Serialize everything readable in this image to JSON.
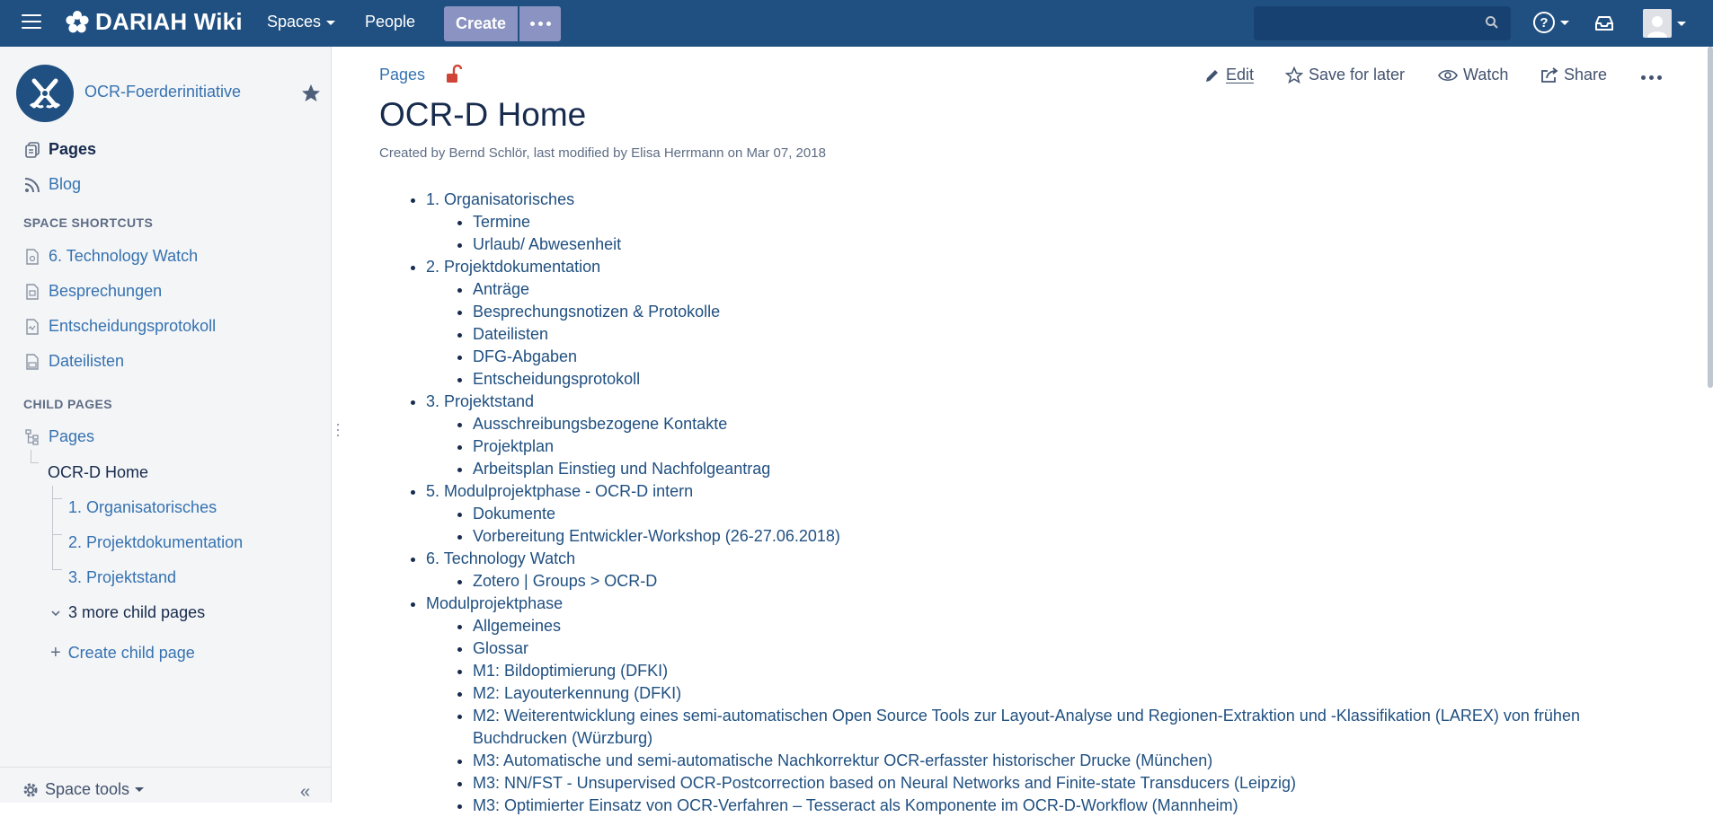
{
  "header": {
    "logo_text": "DARIAH Wiki",
    "spaces_label": "Spaces",
    "people_label": "People",
    "create_label": "Create",
    "search_placeholder": ""
  },
  "sidebar": {
    "space_name": "OCR-Foerderinitiative",
    "nav": [
      {
        "label": "Pages"
      },
      {
        "label": "Blog"
      }
    ],
    "shortcuts_heading": "SPACE SHORTCUTS",
    "shortcuts": [
      {
        "label": "6. Technology Watch"
      },
      {
        "label": "Besprechungen"
      },
      {
        "label": "Entscheidungsprotokoll"
      },
      {
        "label": "Dateilisten"
      }
    ],
    "child_heading": "CHILD PAGES",
    "tree": {
      "root": "Pages",
      "current": "OCR-D Home",
      "children": [
        {
          "label": "1. Organisatorisches"
        },
        {
          "label": "2. Projektdokumentation"
        },
        {
          "label": "3. Projektstand"
        }
      ],
      "more": "3 more child pages",
      "create": "Create child page"
    },
    "space_tools": "Space tools"
  },
  "page": {
    "breadcrumb": "Pages",
    "title": "OCR-D Home",
    "meta": "Created by Bernd Schlör, last modified by Elisa Herrmann on Mar 07, 2018",
    "actions": {
      "edit": "Edit",
      "save": "Save for later",
      "watch": "Watch",
      "share": "Share"
    },
    "tree": [
      {
        "label": "1. Organisatorisches",
        "children": [
          {
            "label": "Termine"
          },
          {
            "label": "Urlaub/ Abwesenheit"
          }
        ]
      },
      {
        "label": "2. Projektdokumentation",
        "children": [
          {
            "label": "Anträge"
          },
          {
            "label": "Besprechungsnotizen & Protokolle"
          },
          {
            "label": "Dateilisten"
          },
          {
            "label": "DFG-Abgaben"
          },
          {
            "label": "Entscheidungsprotokoll"
          }
        ]
      },
      {
        "label": "3. Projektstand",
        "children": [
          {
            "label": "Ausschreibungsbezogene Kontakte"
          },
          {
            "label": "Projektplan"
          },
          {
            "label": "Arbeitsplan Einstieg und Nachfolgeantrag"
          }
        ]
      },
      {
        "label": "5. Modulprojektphase - OCR-D intern",
        "children": [
          {
            "label": "Dokumente"
          },
          {
            "label": "Vorbereitung Entwickler-Workshop (26-27.06.2018)"
          }
        ]
      },
      {
        "label": "6. Technology Watch",
        "children": [
          {
            "label": "Zotero | Groups > OCR-D"
          }
        ]
      },
      {
        "label": "Modulprojektphase",
        "children": [
          {
            "label": "Allgemeines"
          },
          {
            "label": "Glossar"
          },
          {
            "label": "M1: Bildoptimierung (DFKI)"
          },
          {
            "label": "M2: Layouterkennung (DFKI)"
          },
          {
            "label": "M2: Weiterentwicklung eines semi-automatischen Open Source Tools zur Layout-Analyse und Regionen-Extraktion und -Klassifikation (LAREX) von frühen Buchdrucken (Würzburg)"
          },
          {
            "label": "M3: Automatische und semi-automatische Nachkorrektur OCR-erfasster historischer Drucke (München)"
          },
          {
            "label": "M3: NN/FST - Unsupervised OCR-Postcorrection based on Neural Networks and Finite-state Transducers (Leipzig)"
          },
          {
            "label": "M3: Optimierter Einsatz von OCR-Verfahren – Tesseract als Komponente im OCR-D-Workflow (Mannheim)"
          }
        ]
      }
    ]
  },
  "colors": {
    "header_bg": "#205081",
    "link": "#3572b0",
    "create_button": "#8a93c1"
  }
}
